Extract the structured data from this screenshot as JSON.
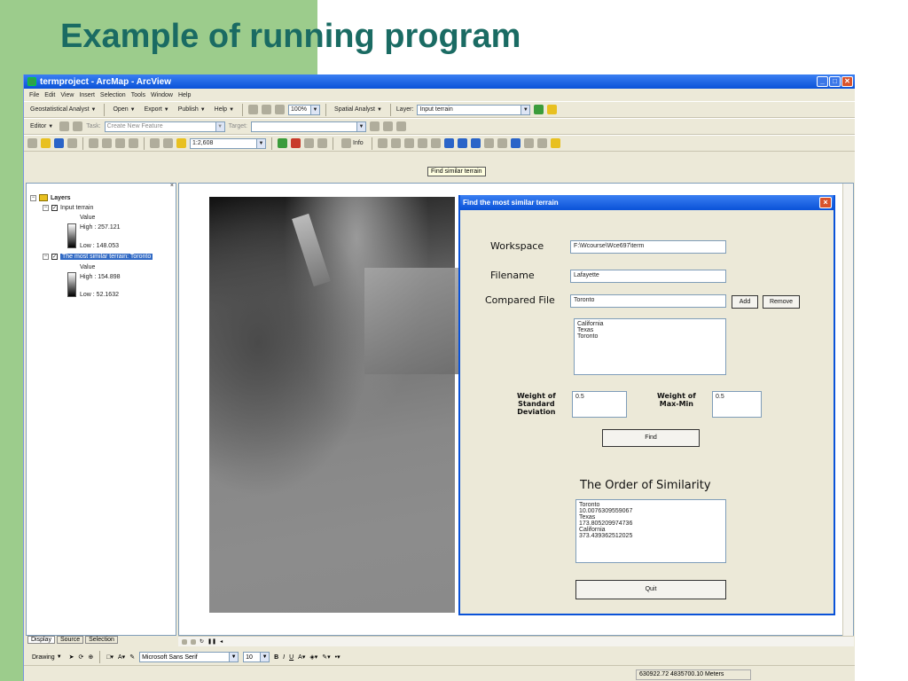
{
  "slide": {
    "title": "Example of running program",
    "colors": {
      "left_band": "#9ccc8c",
      "title": "#1a6b63"
    }
  },
  "app": {
    "window_title": "termproject - ArcMap - ArcView",
    "menu": [
      "File",
      "Edit",
      "View",
      "Insert",
      "Selection",
      "Tools",
      "Window",
      "Help"
    ],
    "toolbar1": {
      "geostat": "Geostatistical Analyst",
      "open": "Open",
      "export": "Export",
      "publish": "Publish",
      "help": "Help",
      "zoom_value": "100%",
      "spatial": "Spatial Analyst",
      "layer_label": "Layer:",
      "layer_value": "Input terrain"
    },
    "toolbar2": {
      "editor": "Editor",
      "task_label": "Task:",
      "task_value": "Create New Feature",
      "target_label": "Target:",
      "target_value": ""
    },
    "toolbar3": {
      "scale": "1:2,608",
      "info": "Info"
    },
    "tooltip": "Find similar terrain",
    "toc": {
      "root": "Layers",
      "layer1": {
        "name": "Input terrain",
        "value_label": "Value",
        "high": "High : 257.121",
        "low": "Low : 148.053"
      },
      "layer2": {
        "name": "The most similar terrain: Toronto",
        "value_label": "Value",
        "high": "High : 154.898",
        "low": "Low : 52.1632"
      },
      "tabs": [
        "Display",
        "Source",
        "Selection"
      ]
    },
    "drawing": {
      "drawing": "Drawing",
      "font": "Microsoft Sans Serif",
      "size": "10",
      "bold": "B",
      "italic": "I",
      "underline": "U"
    },
    "status": {
      "coords": "630922.72  4835700.10 Meters"
    }
  },
  "dialog": {
    "title": "Find the most similar terrain",
    "workspace_label": "Workspace",
    "workspace_value": "F:\\Wcourse\\Wce697\\term",
    "filename_label": "Filename",
    "filename_value": "Lafayette",
    "compared_label": "Compared File",
    "compared_value": "Toronto",
    "add": "Add",
    "remove": "Remove",
    "compared_list": "California\nTexas\nToronto",
    "weight_sd_label": "Weight of\nStandard\nDeviation",
    "weight_sd_value": "0.5",
    "weight_mm_label": "Weight of\nMax-Min",
    "weight_mm_value": "0.5",
    "find": "Find",
    "order_title": "The Order of Similarity",
    "results": "Toronto\n10.0076309559067\nTexas\n173.805209974736\nCalifornia\n373.439362512025",
    "quit": "Quit"
  }
}
